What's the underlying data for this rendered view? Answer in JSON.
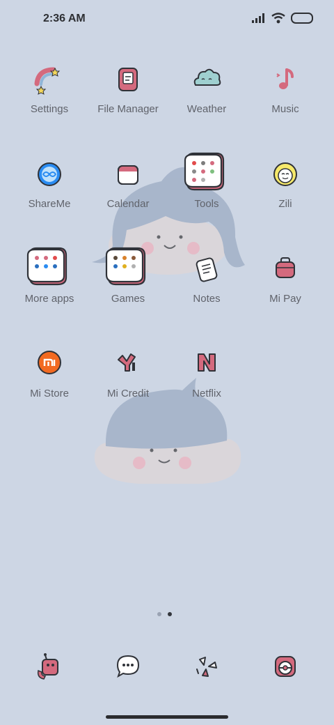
{
  "status": {
    "time": "2:36 AM"
  },
  "apps": {
    "settings": "Settings",
    "file_manager": "File Manager",
    "weather": "Weather",
    "music": "Music",
    "shareme": "ShareMe",
    "calendar": "Calendar",
    "tools": "Tools",
    "zili": "Zili",
    "more_apps": "More apps",
    "games": "Games",
    "notes": "Notes",
    "mi_pay": "Mi Pay",
    "mi_store": "Mi Store",
    "mi_credit": "Mi Credit",
    "netflix": "Netflix"
  },
  "colors": {
    "background": "#cdd6e4",
    "accent_pink": "#d46a7e",
    "outline": "#2f3238",
    "mi_orange": "#f26a21",
    "shareme_blue": "#2a8cf2"
  },
  "pages": {
    "count": 2,
    "active_index": 1
  }
}
